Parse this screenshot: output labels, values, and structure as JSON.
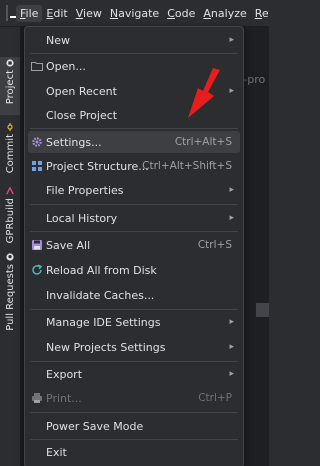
{
  "menubar": {
    "items": [
      {
        "label": "File",
        "mnemonic": "F",
        "active": true
      },
      {
        "label": "Edit",
        "mnemonic": "E"
      },
      {
        "label": "View",
        "mnemonic": "V"
      },
      {
        "label": "Navigate",
        "mnemonic": "N"
      },
      {
        "label": "Code",
        "mnemonic": "C"
      },
      {
        "label": "Analyze",
        "mnemonic": "A"
      },
      {
        "label": "Refactor",
        "mnemonic": "R"
      }
    ]
  },
  "toolstrip": {
    "items": [
      {
        "label": "Project",
        "icon": "project-icon"
      },
      {
        "label": "Commit",
        "icon": "commit-icon"
      },
      {
        "label": "GPRbuild",
        "icon": "gprbuild-icon"
      },
      {
        "label": "Pull Requests",
        "icon": "github-icon"
      }
    ]
  },
  "editor": {
    "tab_label": "liv",
    "partial_text": "th-pro"
  },
  "file_menu": {
    "items": [
      {
        "label": "New",
        "submenu": true
      },
      {
        "label": "Open...",
        "icon": "folder-icon"
      },
      {
        "label": "Open Recent",
        "submenu": true
      },
      {
        "label": "Close Project"
      },
      {
        "label": "Settings...",
        "shortcut": "Ctrl+Alt+S",
        "icon": "gear-icon",
        "highlighted": true
      },
      {
        "label": "Project Structure...",
        "shortcut": "Ctrl+Alt+Shift+S",
        "icon": "structure-icon"
      },
      {
        "label": "File Properties",
        "submenu": true
      },
      {
        "label": "Local History",
        "submenu": true
      },
      {
        "label": "Save All",
        "shortcut": "Ctrl+S",
        "icon": "save-icon"
      },
      {
        "label": "Reload All from Disk",
        "icon": "reload-icon"
      },
      {
        "label": "Invalidate Caches..."
      },
      {
        "label": "Manage IDE Settings",
        "submenu": true
      },
      {
        "label": "New Projects Settings",
        "submenu": true
      },
      {
        "label": "Export",
        "submenu": true
      },
      {
        "label": "Print...",
        "shortcut": "Ctrl+P",
        "icon": "print-icon",
        "disabled": true
      },
      {
        "label": "Power Save Mode"
      },
      {
        "label": "Exit"
      }
    ]
  },
  "colors": {
    "background": "#1e1f22",
    "menu_bg": "#2b2d30",
    "highlight": "#3d3f43",
    "annotation_arrow": "#e81e1e"
  }
}
